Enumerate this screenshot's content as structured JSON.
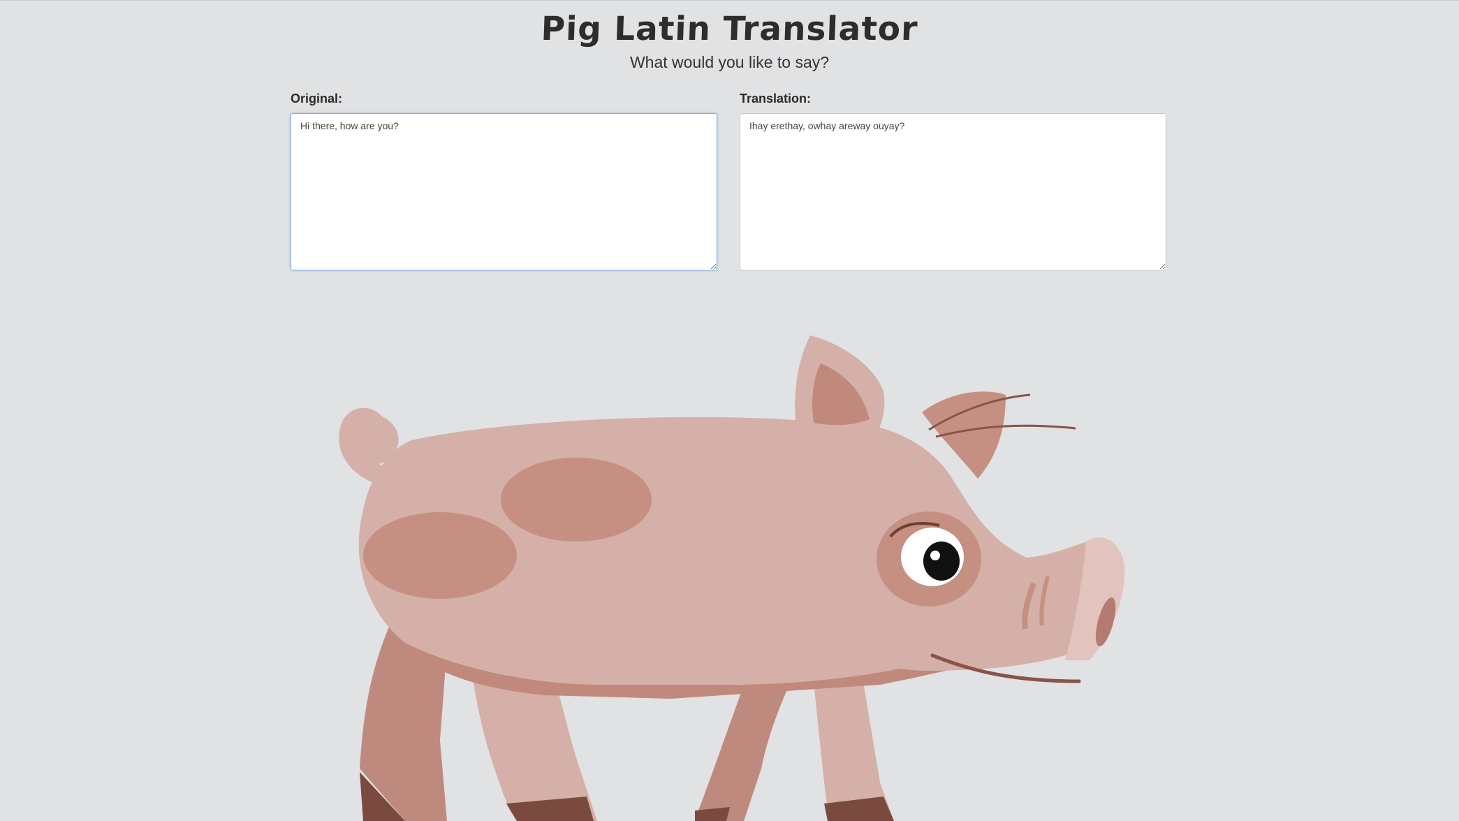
{
  "header": {
    "title": "Pig Latin Translator",
    "subtitle": "What would you like to say?"
  },
  "original": {
    "label": "Original:",
    "value": "Hi there, how are you?"
  },
  "translation": {
    "label": "Translation:",
    "value": "Ihay erethay, owhay areway ouyay?"
  },
  "illustration": {
    "name": "pig-illustration",
    "colors": {
      "body": "#d4b0a8",
      "spots": "#c58f82",
      "shadow": "#c0897c",
      "hooves": "#7a4a3f",
      "snout": "#e2c3bd",
      "background": "#e0e2e4"
    }
  }
}
